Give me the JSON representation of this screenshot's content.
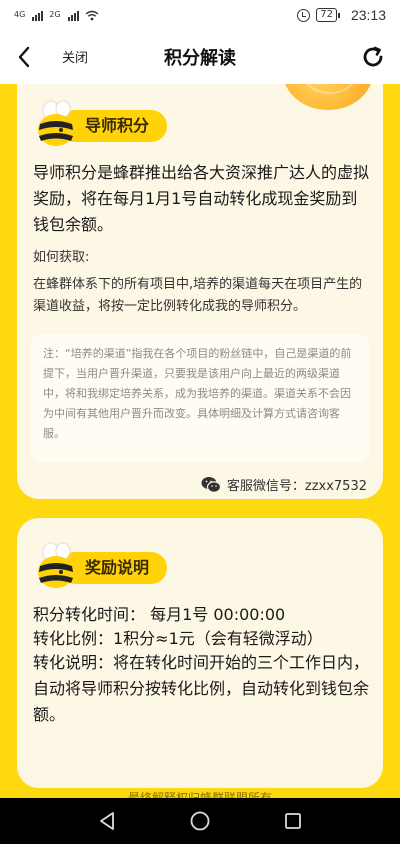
{
  "status_bar": {
    "network_1": "4G",
    "network_2": "2G",
    "battery": "72",
    "time": "23:13"
  },
  "navbar": {
    "close_label": "关闭",
    "title": "积分解读"
  },
  "card1": {
    "badge": "导师积分",
    "description": "导师积分是蜂群推出给各大资深推广达人的虚拟奖励，将在每月1月1号自动转化成现金奖励到钱包余额。",
    "how_title": "如何获取:",
    "how_body": "在蜂群体系下的所有项目中,培养的渠道每天在项目产生的渠道收益，将按一定比例转化成我的导师积分。",
    "note": "注：“培养的渠道”指我在各个项目的粉丝链中，自己是渠道的前提下，当用户晋升渠道，只要我是该用户向上最近的两级渠道中，将和我绑定培养关系，成为我培养的渠道。渠道关系不会因为中间有其他用户晋升而改变。具体明细及计算方式请咨询客服。",
    "wechat": "客服微信号：zzxx7532"
  },
  "card2": {
    "badge": "奖励说明",
    "line1": "积分转化时间：  每月1号 00:00:00",
    "line2": "转化比例：1积分≈1元（会有轻微浮动）",
    "line3": "转化说明：将在转化时间开始的三个工作日内，自动将导师积分按转化比例，自动转化到钱包余额。"
  },
  "footer": "最终解释权归蜂群联盟所有",
  "colors": {
    "accent": "#ffd90f",
    "card": "#fdf7e5"
  }
}
